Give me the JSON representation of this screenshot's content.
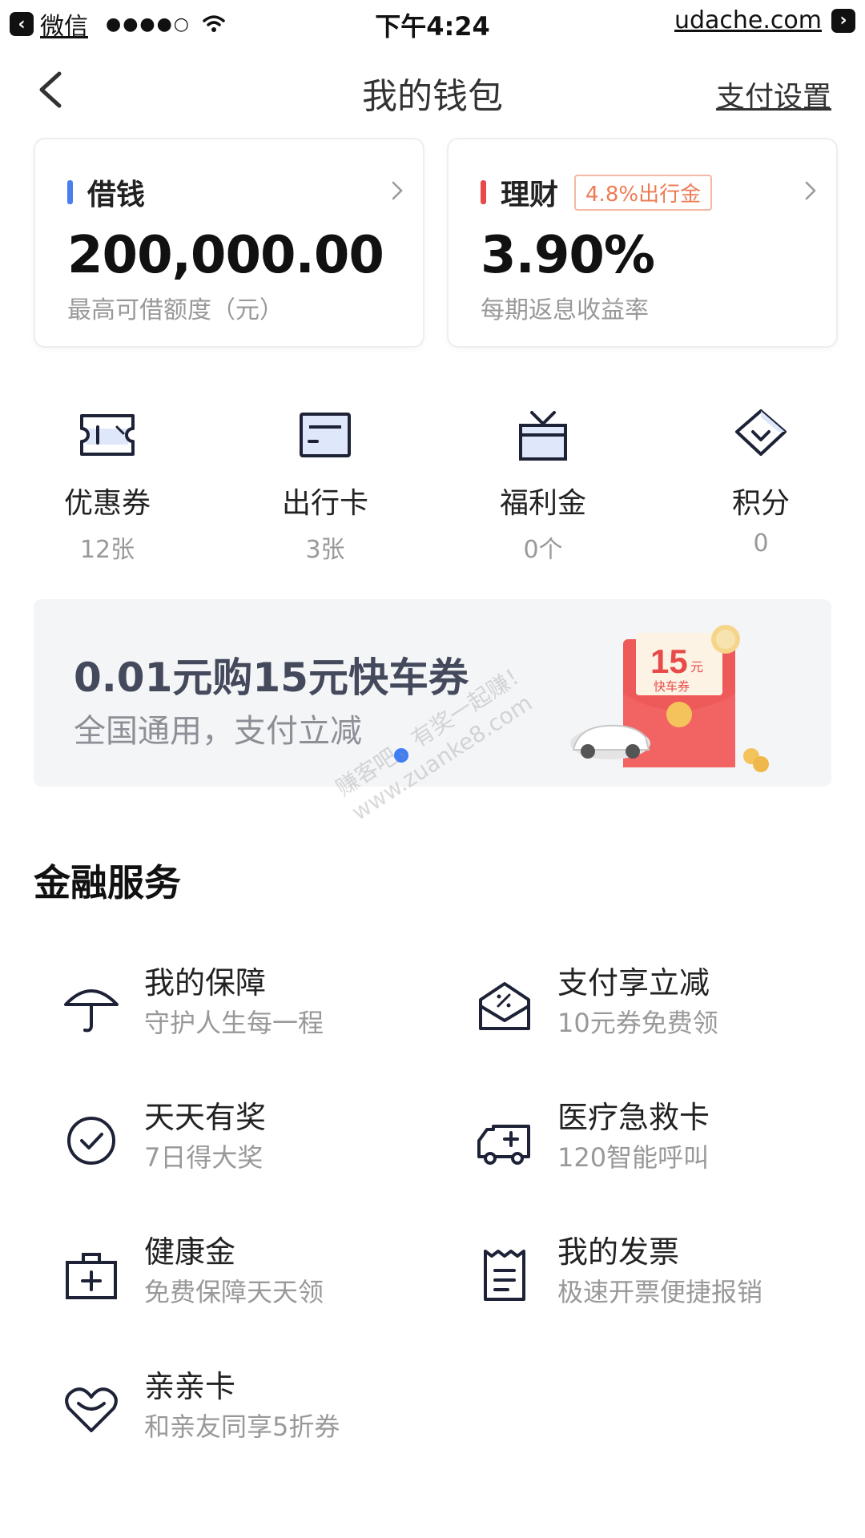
{
  "status_bar": {
    "app": "微信",
    "signal": "●●●●○",
    "time": "下午4:24",
    "domain": "udache.com"
  },
  "nav": {
    "title": "我的钱包",
    "settings": "支付设置"
  },
  "cards": {
    "borrow": {
      "label": "借钱",
      "value": "200,000.00",
      "sub": "最高可借额度（元）",
      "bar_color": "#4a7df0"
    },
    "invest": {
      "label": "理财",
      "tag": "4.8%出行金",
      "value": "3.90%",
      "sub": "每期返息收益率",
      "bar_color": "#e84a4a"
    }
  },
  "quick": [
    {
      "label": "优惠券",
      "count": "12张",
      "icon": "ticket-icon"
    },
    {
      "label": "出行卡",
      "count": "3张",
      "icon": "card-icon"
    },
    {
      "label": "福利金",
      "count": "0个",
      "icon": "gift-box-icon"
    },
    {
      "label": "积分",
      "count": "0",
      "icon": "diamond-icon"
    }
  ],
  "banner": {
    "title": "0.01元购15元快车券",
    "subtitle": "全国通用，支付立减",
    "envelope_amount": "15",
    "envelope_unit": "元",
    "envelope_label": "快车券"
  },
  "watermark": {
    "line1": "赚客吧，有奖一起赚！",
    "line2": "www.zuanke8.com"
  },
  "finance": {
    "title": "金融服务",
    "items": [
      {
        "title": "我的保障",
        "sub": "守护人生每一程",
        "icon": "umbrella-icon"
      },
      {
        "title": "支付享立减",
        "sub": "10元券免费领",
        "icon": "envelope-discount-icon"
      },
      {
        "title": "天天有奖",
        "sub": "7日得大奖",
        "icon": "check-circle-icon"
      },
      {
        "title": "医疗急救卡",
        "sub": "120智能呼叫",
        "icon": "ambulance-icon"
      },
      {
        "title": "健康金",
        "sub": "免费保障天天领",
        "icon": "medical-kit-icon"
      },
      {
        "title": "我的发票",
        "sub": "极速开票便捷报销",
        "icon": "invoice-icon"
      },
      {
        "title": "亲亲卡",
        "sub": "和亲友同享5折券",
        "icon": "heart-icon"
      }
    ]
  }
}
